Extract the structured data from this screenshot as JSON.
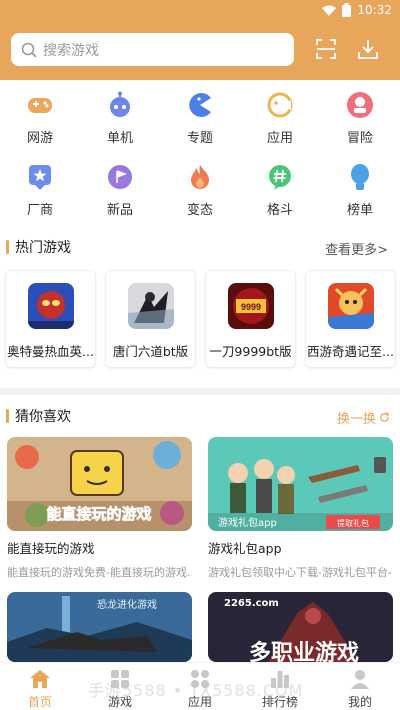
{
  "status_bar": {
    "time": "10:32",
    "icons": [
      "wifi-icon",
      "battery-icon"
    ]
  },
  "header": {
    "search_placeholder": "搜索游戏",
    "accent_color": "#e7a65b",
    "buttons": [
      "scan-icon",
      "download-icon"
    ]
  },
  "categories": [
    {
      "label": "网游",
      "icon": "gamepad-icon",
      "color": "#e9a85d"
    },
    {
      "label": "单机",
      "icon": "robot-icon",
      "color": "#6f86e8"
    },
    {
      "label": "专题",
      "icon": "pacman-icon",
      "color": "#4d7fe8"
    },
    {
      "label": "应用",
      "icon": "face-icon",
      "color": "#f0b44c"
    },
    {
      "label": "冒险",
      "icon": "adventure-icon",
      "color": "#ef6f7a"
    },
    {
      "label": "厂商",
      "icon": "star-badge-icon",
      "color": "#6e8ce9"
    },
    {
      "label": "新品",
      "icon": "new-flag-icon",
      "color": "#9b78e0"
    },
    {
      "label": "变态",
      "icon": "flame-icon",
      "color": "#f07a4c"
    },
    {
      "label": "格斗",
      "icon": "hash-icon",
      "color": "#4cc47a"
    },
    {
      "label": "榜单",
      "icon": "balloon-icon",
      "color": "#4aa3e6"
    }
  ],
  "hot_games": {
    "title": "热门游戏",
    "more": "查看更多>",
    "items": [
      {
        "name": "奥特曼热血英...",
        "icon": "ultraman-game-icon"
      },
      {
        "name": "唐门六道bt版",
        "icon": "ninja-game-icon"
      },
      {
        "name": "一刀9999bt版",
        "icon": "sword-9999-game-icon"
      },
      {
        "name": "西游奇遇记至...",
        "icon": "journey-west-game-icon"
      }
    ]
  },
  "guess": {
    "title": "猜你喜欢",
    "swap": "换一换",
    "items": [
      {
        "title": "能直接玩的游戏",
        "desc": "能直接玩的游戏免费-能直接玩的游戏...",
        "banner_text": "能直接玩的游戏"
      },
      {
        "title": "游戏礼包app",
        "desc": "游戏礼包领取中心下载-游戏礼包平台-...",
        "banner_text": "游戏礼包app",
        "banner_btn": "提取礼包"
      },
      {
        "title": "",
        "desc": "",
        "banner_text": "恐龙进化游戏"
      },
      {
        "title": "",
        "desc": "",
        "banner_text": "多职业游戏",
        "banner_logo": "2265.com"
      }
    ]
  },
  "bottom_nav": [
    {
      "label": "首页",
      "icon": "home-icon",
      "active": true
    },
    {
      "label": "游戏",
      "icon": "grid-icon",
      "active": false
    },
    {
      "label": "应用",
      "icon": "apps-icon",
      "active": false
    },
    {
      "label": "排行榜",
      "icon": "rank-icon",
      "active": false
    },
    {
      "label": "我的",
      "icon": "user-icon",
      "active": false
    }
  ],
  "watermark": "手游5588 • TX5588.COM"
}
